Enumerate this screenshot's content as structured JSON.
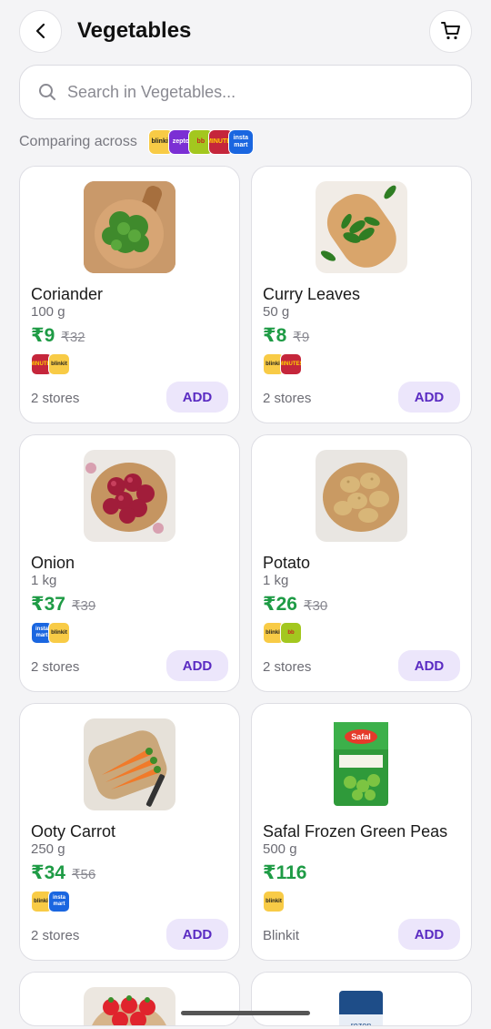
{
  "header": {
    "title": "Vegetables",
    "back_icon": "chevron-left-icon",
    "cart_icon": "cart-icon"
  },
  "search": {
    "placeholder": "Search in Vegetables..."
  },
  "compare": {
    "label": "Comparing across",
    "stores": [
      {
        "key": "blinkit",
        "label": "blinkit",
        "bg": "#f8cb46",
        "fg": "#1e1e1e"
      },
      {
        "key": "zepto",
        "label": "zepto",
        "bg": "#7b2fd4",
        "fg": "#ffffff"
      },
      {
        "key": "bigbasket",
        "label": "bb",
        "bg": "#a3c71f",
        "fg": "#c7231a"
      },
      {
        "key": "flipkart",
        "label": "MINUTES",
        "bg": "#c5263b",
        "fg": "#ffd400"
      },
      {
        "key": "instamart",
        "label": "insta mart",
        "bg": "#1a66e0",
        "fg": "#ffffff"
      }
    ]
  },
  "colors": {
    "price": "#1e9b45",
    "add_bg": "#ece6fb",
    "add_fg": "#5a2bc2"
  },
  "products": [
    {
      "name": "Coriander",
      "qty": "100 g",
      "price": "₹9",
      "mrp": "₹32",
      "stores_text": "2 stores",
      "add_label": "ADD",
      "store_logos": [
        "flipkart",
        "blinkit"
      ],
      "image": "coriander"
    },
    {
      "name": "Curry Leaves",
      "qty": "50 g",
      "price": "₹8",
      "mrp": "₹9",
      "stores_text": "2 stores",
      "add_label": "ADD",
      "store_logos": [
        "blinkit",
        "flipkart"
      ],
      "image": "curry-leaves"
    },
    {
      "name": "Onion",
      "qty": "1 kg",
      "price": "₹37",
      "mrp": "₹39",
      "stores_text": "2 stores",
      "add_label": "ADD",
      "store_logos": [
        "instamart",
        "blinkit"
      ],
      "image": "onion"
    },
    {
      "name": "Potato",
      "qty": "1 kg",
      "price": "₹26",
      "mrp": "₹30",
      "stores_text": "2 stores",
      "add_label": "ADD",
      "store_logos": [
        "blinkit",
        "bigbasket"
      ],
      "image": "potato"
    },
    {
      "name": "Ooty Carrot",
      "qty": "250 g",
      "price": "₹34",
      "mrp": "₹56",
      "stores_text": "2 stores",
      "add_label": "ADD",
      "store_logos": [
        "blinkit",
        "instamart"
      ],
      "image": "carrot"
    },
    {
      "name": "Safal Frozen Green Peas",
      "qty": "500 g",
      "price": "₹116",
      "mrp": "",
      "stores_text": "Blinkit",
      "add_label": "ADD",
      "store_logos": [
        "blinkit"
      ],
      "image": "peas"
    }
  ],
  "partial_products": [
    {
      "image": "strawberry"
    },
    {
      "image": "frozen-pack"
    }
  ]
}
